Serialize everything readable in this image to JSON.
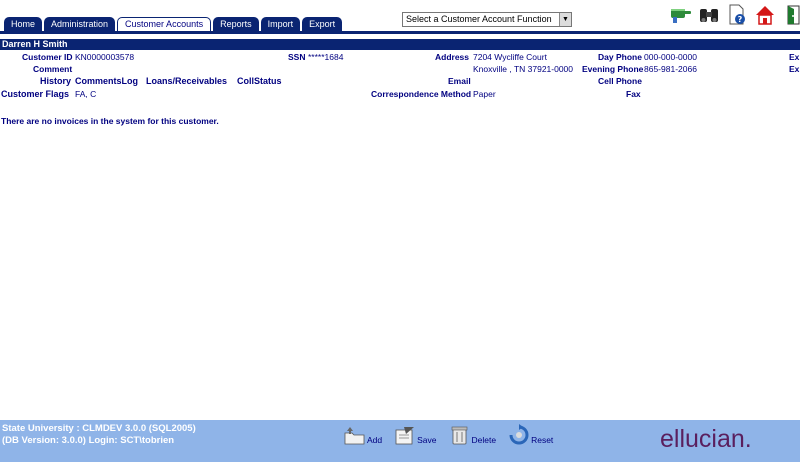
{
  "tabs": [
    {
      "label": "Home"
    },
    {
      "label": "Administration"
    },
    {
      "label": "Customer Accounts"
    },
    {
      "label": "Reports"
    },
    {
      "label": "Import"
    },
    {
      "label": "Export"
    }
  ],
  "function_select": {
    "selected": "Select a Customer Account Function"
  },
  "customer": {
    "name": "Darren H Smith",
    "customer_id_label": "Customer ID",
    "customer_id": "KN0000003578",
    "ssn_label": "SSN",
    "ssn": "*****1684",
    "address_label": "Address",
    "address_line1": "7204 Wycliffe Court",
    "address_line2": "Knoxville , TN 37921-0000",
    "day_phone_label": "Day Phone",
    "day_phone": "000-000-0000",
    "evening_phone_label": "Evening Phone",
    "evening_phone": "865-981-2066",
    "cell_phone_label": "Cell Phone",
    "fax_label": "Fax",
    "ext1": "Ex",
    "ext2": "Ex",
    "comment_label": "Comment",
    "email_label": "Email",
    "correspondence_label": "Correspondence Method",
    "correspondence": "Paper",
    "flags_label": "Customer Flags",
    "flags": "FA, C"
  },
  "links": {
    "history_label": "History",
    "comments_log": "CommentsLog",
    "loans": "Loans/Receivables",
    "coll_status": "CollStatus"
  },
  "message": "There are no invoices in the system for this customer.",
  "footer": {
    "line1": "State University : CLMDEV 3.0.0 (SQL2005)",
    "line2": "(DB Version: 3.0.0) Login: SCT\\tobrien",
    "add": "Add",
    "save": "Save",
    "delete": "Delete",
    "reset": "Reset",
    "brand": "ellucian."
  },
  "icons": [
    "pointing-hand-icon",
    "binoculars-icon",
    "help-document-icon",
    "home-icon",
    "exit-door-icon"
  ]
}
